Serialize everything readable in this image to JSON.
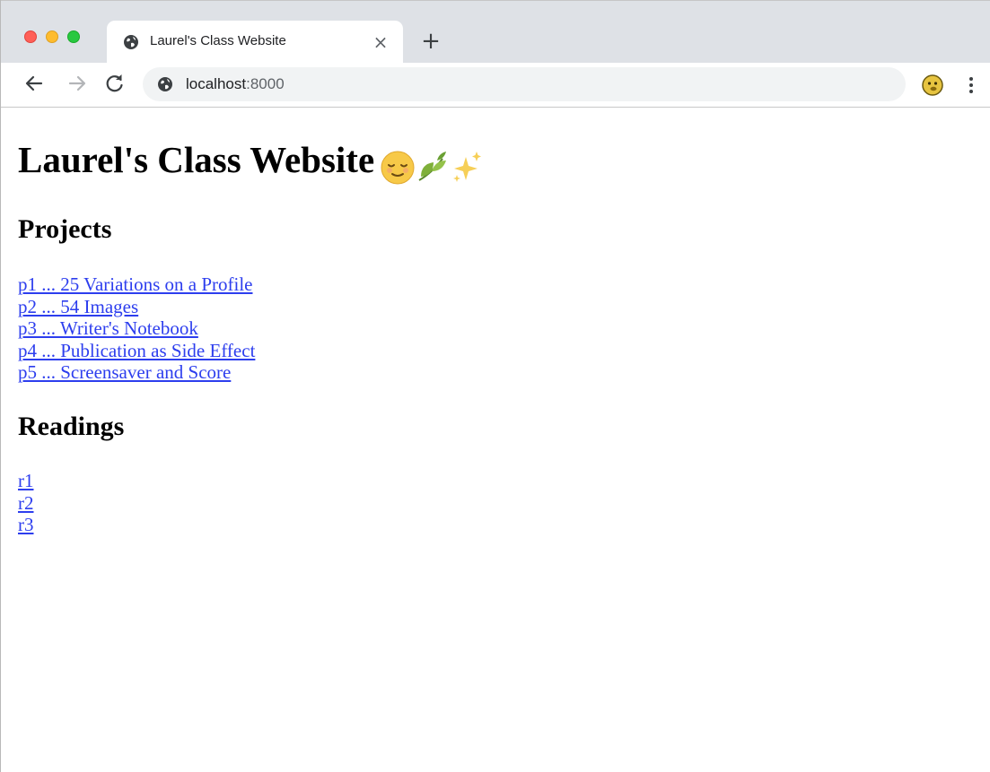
{
  "browser": {
    "tab": {
      "title": "Laurel's Class Website",
      "close_glyph": "×",
      "favicon": "globe-icon"
    },
    "new_tab_glyph": "+",
    "address_bar": {
      "host": "localhost",
      "port": ":8000",
      "icon": "globe-icon"
    },
    "nav": {
      "back": "back-arrow-icon",
      "forward": "forward-arrow-icon",
      "reload": "reload-icon"
    },
    "profile_icon": "profile-avatar-icon",
    "menu_icon": "kebab-menu-icon"
  },
  "page": {
    "title": "Laurel's Class Website",
    "title_emojis": [
      "relieved-face",
      "herb",
      "sparkles"
    ],
    "projects": {
      "heading": "Projects",
      "items": [
        {
          "label": "p1 ... 25 Variations on a Profile"
        },
        {
          "label": "p2 ... 54 Images"
        },
        {
          "label": "p3 ... Writer's Notebook"
        },
        {
          "label": "p4 ... Publication as Side Effect"
        },
        {
          "label": "p5 ... Screensaver and Score"
        }
      ]
    },
    "readings": {
      "heading": "Readings",
      "items": [
        {
          "label": "r1"
        },
        {
          "label": "r2"
        },
        {
          "label": "r3"
        }
      ]
    }
  },
  "colors": {
    "link": "#2d3eee",
    "tabstrip": "#dee1e6",
    "omnibox": "#f1f3f4",
    "close_red": "#ff5f57",
    "minimize_yellow": "#febc2e",
    "zoom_green": "#28c840"
  }
}
